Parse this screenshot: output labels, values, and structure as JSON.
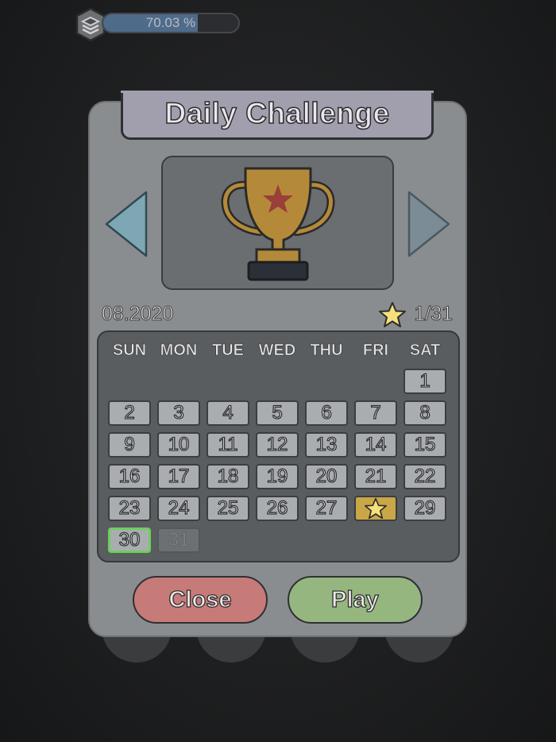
{
  "progress": {
    "text": "70.03 %",
    "fraction": 0.7003
  },
  "dialog": {
    "title": "Daily Challenge",
    "month": "08.2020",
    "score": "1/31",
    "weekdays": [
      "SUN",
      "MON",
      "TUE",
      "WED",
      "THU",
      "FRI",
      "SAT"
    ],
    "days": [
      {
        "label": "1",
        "state": "normal"
      },
      {
        "label": "2",
        "state": "normal"
      },
      {
        "label": "3",
        "state": "normal"
      },
      {
        "label": "4",
        "state": "normal"
      },
      {
        "label": "5",
        "state": "normal"
      },
      {
        "label": "6",
        "state": "normal"
      },
      {
        "label": "7",
        "state": "normal"
      },
      {
        "label": "8",
        "state": "normal"
      },
      {
        "label": "9",
        "state": "normal"
      },
      {
        "label": "10",
        "state": "normal"
      },
      {
        "label": "11",
        "state": "normal"
      },
      {
        "label": "12",
        "state": "normal"
      },
      {
        "label": "13",
        "state": "normal"
      },
      {
        "label": "14",
        "state": "normal"
      },
      {
        "label": "15",
        "state": "normal"
      },
      {
        "label": "16",
        "state": "normal"
      },
      {
        "label": "17",
        "state": "normal"
      },
      {
        "label": "18",
        "state": "normal"
      },
      {
        "label": "19",
        "state": "normal"
      },
      {
        "label": "20",
        "state": "normal"
      },
      {
        "label": "21",
        "state": "normal"
      },
      {
        "label": "22",
        "state": "normal"
      },
      {
        "label": "23",
        "state": "normal"
      },
      {
        "label": "24",
        "state": "normal"
      },
      {
        "label": "25",
        "state": "normal"
      },
      {
        "label": "26",
        "state": "normal"
      },
      {
        "label": "27",
        "state": "normal"
      },
      {
        "label": "",
        "state": "done"
      },
      {
        "label": "29",
        "state": "normal"
      },
      {
        "label": "30",
        "state": "today"
      },
      {
        "label": "31",
        "state": "future"
      }
    ],
    "first_weekday": 6,
    "close_label": "Close",
    "play_label": "Play"
  },
  "icons": {
    "trophy": "trophy-icon",
    "prev": "arrow-left-icon",
    "next": "arrow-right-icon",
    "star": "star-icon",
    "level": "layers-icon"
  },
  "colors": {
    "close": "#c77b78",
    "play": "#95b77f",
    "trophy": "#b48a3a",
    "star": "#f5e07a",
    "today_border": "#6ccf5e"
  }
}
